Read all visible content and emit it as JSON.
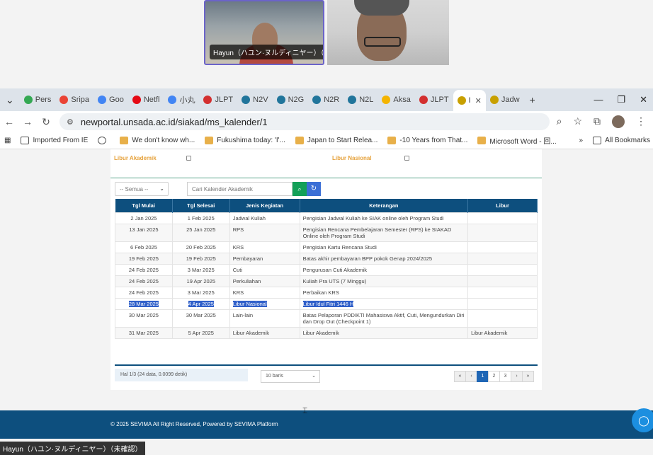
{
  "call": {
    "participant1_name": "Hayun（ハユン·ヌルディニヤー）（未確認）",
    "bottom_tag": "Hayun（ハユン·ヌルディニヤー）（未確認）"
  },
  "tabs": [
    {
      "label": "Pers",
      "color": "#34a853"
    },
    {
      "label": "Sripa",
      "color": "#ea4335"
    },
    {
      "label": "Goo",
      "color": "#4285f4"
    },
    {
      "label": "Netfl",
      "color": "#e50914"
    },
    {
      "label": "小丸",
      "color": "#4285f4"
    },
    {
      "label": "JLPT",
      "color": "#d32f2f"
    },
    {
      "label": "N2V",
      "color": "#21759b"
    },
    {
      "label": "N2G",
      "color": "#21759b"
    },
    {
      "label": "N2R",
      "color": "#21759b"
    },
    {
      "label": "N2L",
      "color": "#21759b"
    },
    {
      "label": "Aksa",
      "color": "#f4b400"
    },
    {
      "label": "JLPT",
      "color": "#d32f2f"
    },
    {
      "label": "I",
      "color": "#c8a000",
      "active": true
    },
    {
      "label": "Jadw",
      "color": "#c8a000"
    }
  ],
  "address": {
    "url": "newportal.unsada.ac.id/siakad/ms_kalender/1"
  },
  "bookmarks": [
    {
      "label": "Imported From IE",
      "icon": "folder-icon"
    },
    {
      "label": "",
      "icon": "globe-icon"
    },
    {
      "label": "We don't know wh...",
      "icon": "bookmark-icon"
    },
    {
      "label": "Fukushima today: 'I'...",
      "icon": "bookmark-icon"
    },
    {
      "label": "Japan to Start Relea...",
      "icon": "bookmark-icon"
    },
    {
      "label": "-10 Years from That...",
      "icon": "bookmark-icon"
    },
    {
      "label": "Microsoft Word - 回...",
      "icon": "bookmark-icon"
    }
  ],
  "all_bookmarks": "All Bookmarks",
  "legend": {
    "libur_akademik": "Libur Akademik",
    "libur_nasional": "Libur Nasional"
  },
  "filter": {
    "select_value": "-- Semua --",
    "search_placeholder": "Cari Kalender Akademik"
  },
  "table": {
    "headers": [
      "Tgl Mulai",
      "Tgl Selesai",
      "Jenis Kegiatan",
      "Keterangan",
      "Libur"
    ],
    "rows": [
      {
        "mulai": "2 Jan 2025",
        "selesai": "1 Feb 2025",
        "jenis": "Jadwal Kuliah",
        "ket": "Pengisian Jadwal Kuliah ke SIAK online oleh Program Studi",
        "libur": ""
      },
      {
        "mulai": "13 Jan 2025",
        "selesai": "25 Jan 2025",
        "jenis": "RPS",
        "ket": "Pengisian Rencana Pembelajaran Semester (RPS) ke SIAKAD Online oleh Program Studi",
        "libur": ""
      },
      {
        "mulai": "6 Feb 2025",
        "selesai": "20 Feb 2025",
        "jenis": "KRS",
        "ket": "Pengisian Kartu Rencana Studi",
        "libur": ""
      },
      {
        "mulai": "19 Feb 2025",
        "selesai": "19 Feb 2025",
        "jenis": "Pembayaran",
        "ket": "Batas akhir pembayaran BPP pokok Genap 2024/2025",
        "libur": ""
      },
      {
        "mulai": "24 Feb 2025",
        "selesai": "3 Mar 2025",
        "jenis": "Cuti",
        "ket": "Pengurusan Cuti Akademik",
        "libur": ""
      },
      {
        "mulai": "24 Feb 2025",
        "selesai": "19 Apr 2025",
        "jenis": "Perkuliahan",
        "ket": "Kuliah Pra UTS (7 Minggu)",
        "libur": ""
      },
      {
        "mulai": "24 Feb 2025",
        "selesai": "3 Mar 2025",
        "jenis": "KRS",
        "ket": "Perbaikan KRS",
        "libur": ""
      },
      {
        "mulai": "28 Mar 2025",
        "selesai": "4 Apr 2025",
        "jenis": "Libur Nasional",
        "ket": "Libur Idul Fitri 1446 H",
        "libur": "",
        "selected": true
      },
      {
        "mulai": "30 Mar 2025",
        "selesai": "30 Mar 2025",
        "jenis": "Lain-lain",
        "ket": "Batas Pelaporan PDDIKTI Mahasiswa Aktif, Cuti, Mengundurkan Diri dan Drop Out (Checkpoint 1)",
        "libur": ""
      },
      {
        "mulai": "31 Mar 2025",
        "selesai": "5 Apr 2025",
        "jenis": "Libur Akademik",
        "ket": "Libur Akademik",
        "libur": "Libur Akademik"
      }
    ]
  },
  "pagination": {
    "info": "Hal 1/3 (24 data, 0.0099 detik)",
    "page_size": "10 baris",
    "pages": [
      "«",
      "‹",
      "1",
      "2",
      "3",
      "›",
      "»"
    ],
    "current": "1"
  },
  "footer": {
    "text": "© 2025 SEVIMA All Right Reserved, Powered by SEVIMA Platform"
  }
}
